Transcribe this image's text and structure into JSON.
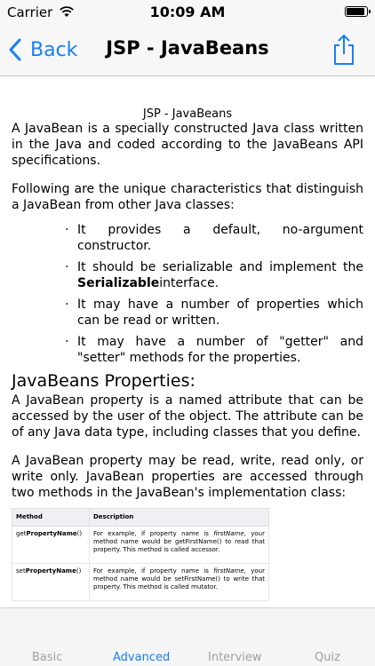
{
  "status_bar": {
    "carrier": "Carrier",
    "time": "10:09 AM",
    "battery_level": 0.95
  },
  "nav": {
    "back_label": "Back",
    "title": "JSP - JavaBeans"
  },
  "content": {
    "doc_title": "JSP - JavaBeans",
    "intro": "A JavaBean is a specially constructed Java class written in the Java and coded according to the JavaBeans API specifications.",
    "characteristics_intro": "Following are the unique characteristics that distinguish a JavaBean from other Java classes:",
    "bullets": {
      "b1": "It provides a default, no-argument constructor.",
      "b2_prefix": "It should be serializable and implement the ",
      "b2_bold": "Serializable",
      "b2_suffix": "interface.",
      "b3": "It may have a number of properties which can be read or written.",
      "b4": "It may have a number of \"getter\" and \"setter\" methods for the properties."
    },
    "properties_heading": "JavaBeans Properties:",
    "properties_p1": "A JavaBean property is a named attribute that can be accessed by the user of the object. The attribute can be of any Java data type, including classes that you define.",
    "properties_p2": "A JavaBean property may be read, write, read only, or write only. JavaBean properties are accessed through two methods in the JavaBean's implementation class:",
    "table": {
      "headers": [
        "Method",
        "Description"
      ],
      "rows": [
        {
          "prefix": "get",
          "name": "PropertyName",
          "suffix": "()",
          "desc_a": "For example, if property name is ",
          "desc_italic": "firstName",
          "desc_b": ", your method name would be getFirstName() to read that property. This method is called accessor."
        },
        {
          "prefix": "set",
          "name": "PropertyName",
          "suffix": "()",
          "desc_a": "For example, if property name is ",
          "desc_italic": "firstName",
          "desc_b": ", your method name would be setFirstName() to write that property. This method is called mutator."
        }
      ]
    }
  },
  "tab_bar": {
    "tabs": [
      "Basic",
      "Advanced",
      "Interview",
      "Quiz"
    ],
    "active": "Advanced",
    "colors": {
      "active": "#1a7ff6",
      "inactive": "#a0a0a0"
    }
  }
}
